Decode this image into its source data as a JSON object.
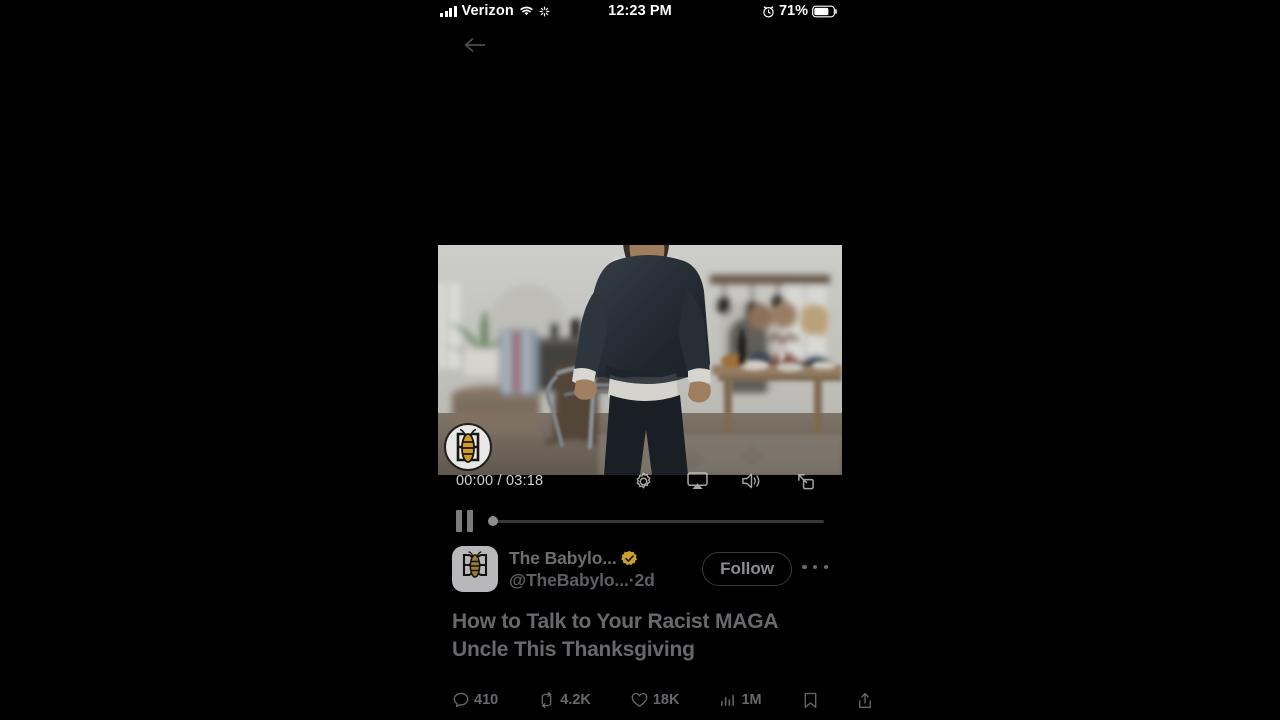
{
  "status_bar": {
    "carrier": "Verizon",
    "signal_icon": "cellular-signal-icon",
    "wifi_icon": "wifi-icon",
    "sync_icon": "network-activity-icon",
    "time": "12:23 PM",
    "alarm_icon": "alarm-clock-icon",
    "battery_percent": "71%",
    "battery_icon": "battery-icon"
  },
  "nav": {
    "back_icon": "back-arrow-icon"
  },
  "video": {
    "watermark": "babylon-bee-logo",
    "scene_description": "man in dark sweater standing beside a chair in a dining room with family seated at table",
    "current_time": "00:00",
    "duration": "03:18",
    "time_display": "00:00 / 03:18",
    "progress_percent": 0,
    "state": "playing",
    "controls": {
      "pause_icon": "pause-icon",
      "settings_icon": "gear-icon",
      "cast_icon": "airplay-icon",
      "volume_icon": "volume-icon",
      "pip_icon": "picture-in-picture-icon"
    }
  },
  "post": {
    "avatar_icon": "babylon-bee-avatar",
    "display_name": "The Babylo...",
    "verified_badge": "verified-gold-badge",
    "handle": "@TheBabylo...",
    "separator": "·",
    "timestamp": "2d",
    "follow_label": "Follow",
    "more_icon": "more-options-icon",
    "text": "How to Talk to Your Racist MAGA Uncle This Thanksgiving"
  },
  "engagement": {
    "reply": {
      "icon": "reply-icon",
      "count": "410"
    },
    "repost": {
      "icon": "repost-icon",
      "count": "4.2K"
    },
    "like": {
      "icon": "like-heart-icon",
      "count": "18K"
    },
    "views": {
      "icon": "views-bar-chart-icon",
      "count": "1M"
    },
    "bookmark_icon": "bookmark-icon",
    "share_icon": "share-icon"
  },
  "colors": {
    "background": "#000000",
    "text_dim": "#68686d",
    "verified_gold": "#c9a227",
    "control_gray": "#d2d2d4"
  }
}
